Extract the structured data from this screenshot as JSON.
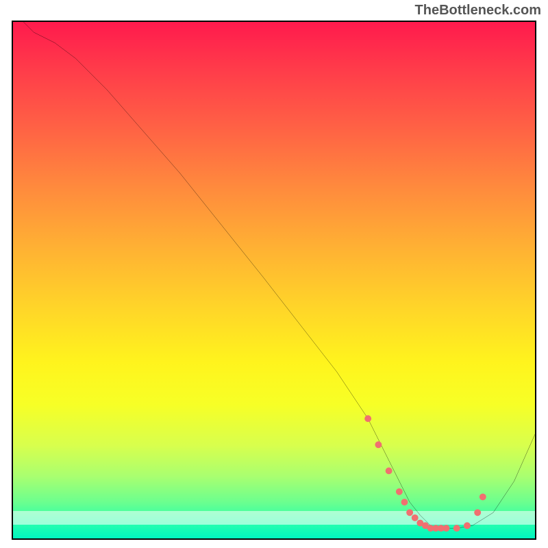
{
  "watermark": "TheBottleneck.com",
  "chart_data": {
    "type": "line",
    "title": "",
    "xlabel": "",
    "ylabel": "",
    "xlim": [
      0,
      100
    ],
    "ylim": [
      0,
      100
    ],
    "series": [
      {
        "name": "curve",
        "x": [
          2,
          4,
          8,
          12,
          18,
          25,
          32,
          40,
          48,
          55,
          62,
          68,
          70,
          72,
          74,
          76,
          78,
          79,
          80,
          81,
          82,
          83,
          85,
          88,
          92,
          96,
          100
        ],
        "y": [
          100,
          98,
          96,
          93,
          87,
          79,
          71,
          61,
          51,
          42,
          33,
          24,
          20,
          16,
          12,
          8,
          5.5,
          4.5,
          3.5,
          3,
          3,
          3,
          3,
          3.5,
          6,
          12,
          21
        ]
      }
    ],
    "markers": {
      "name": "dots",
      "x": [
        68,
        70,
        72,
        74,
        75,
        76,
        77,
        78,
        79,
        80,
        81,
        82,
        83,
        85,
        87,
        89,
        90
      ],
      "y": [
        24,
        19,
        14,
        10,
        8,
        6,
        5,
        4,
        3.5,
        3,
        3,
        3,
        3,
        3,
        3.5,
        6,
        9
      ]
    },
    "colors": {
      "curve": "#000000",
      "markers": "#f07070",
      "gradient_top": "#ff1a4d",
      "gradient_mid": "#ffe028",
      "gradient_bottom": "#00f5c0"
    }
  }
}
